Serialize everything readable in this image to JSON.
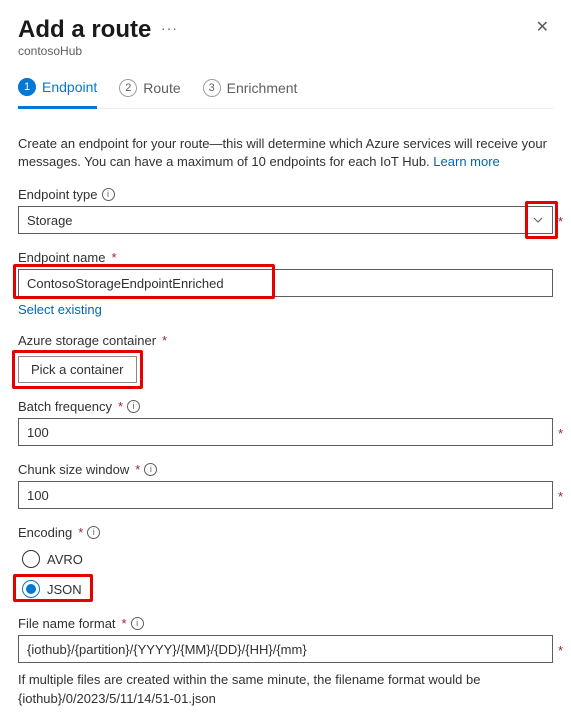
{
  "header": {
    "title": "Add a route",
    "subtitle": "contosoHub"
  },
  "tabs": [
    {
      "num": "1",
      "label": "Endpoint",
      "active": true
    },
    {
      "num": "2",
      "label": "Route",
      "active": false
    },
    {
      "num": "3",
      "label": "Enrichment",
      "active": false
    }
  ],
  "intro": {
    "text": "Create an endpoint for your route—this will determine which Azure services will receive your messages. You can have a maximum of 10 endpoints for each IoT Hub. ",
    "learn_more": "Learn more"
  },
  "fields": {
    "endpoint_type": {
      "label": "Endpoint type",
      "value": "Storage"
    },
    "endpoint_name": {
      "label": "Endpoint name",
      "value": "ContosoStorageEndpointEnriched",
      "select_existing": "Select existing"
    },
    "container": {
      "label": "Azure storage container",
      "button": "Pick a container"
    },
    "batch": {
      "label": "Batch frequency",
      "value": "100"
    },
    "chunk": {
      "label": "Chunk size window",
      "value": "100"
    },
    "encoding": {
      "label": "Encoding",
      "options": [
        {
          "label": "AVRO",
          "selected": false
        },
        {
          "label": "JSON",
          "selected": true
        }
      ]
    },
    "filename": {
      "label": "File name format",
      "value": "{iothub}/{partition}/{YYYY}/{MM}/{DD}/{HH}/{mm}",
      "helper": "If multiple files are created within the same minute, the filename format would be {iothub}/0/2023/5/11/14/51-01.json"
    }
  }
}
